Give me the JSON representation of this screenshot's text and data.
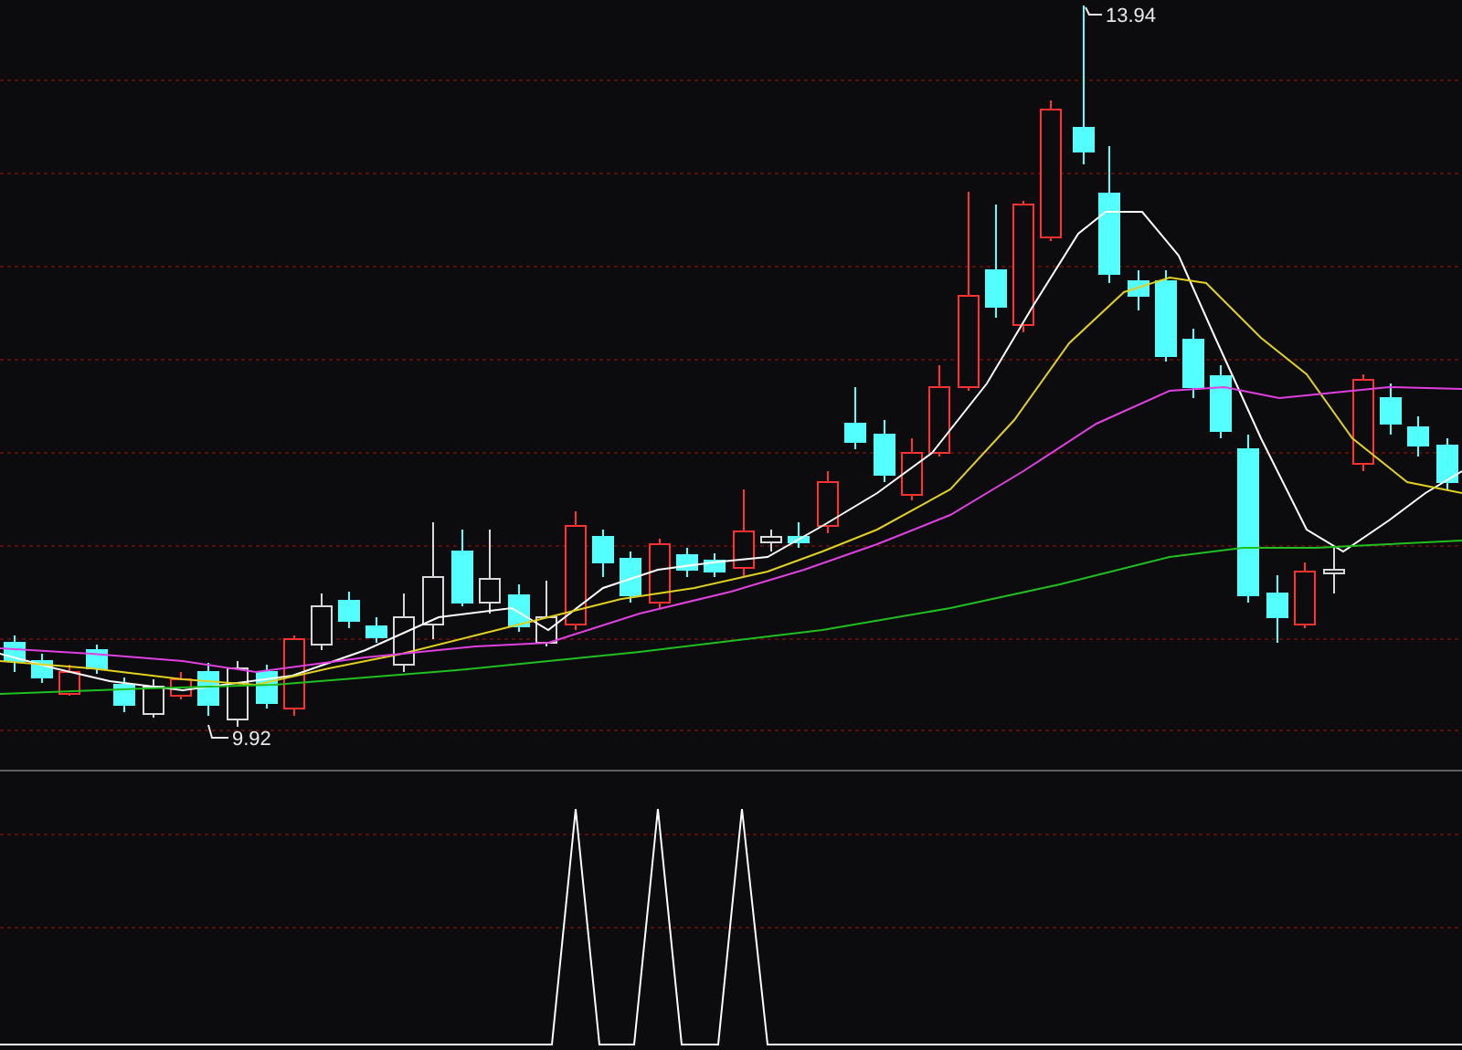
{
  "price_chart": {
    "high_label": "13.94",
    "low_label": "9.92"
  }
}
